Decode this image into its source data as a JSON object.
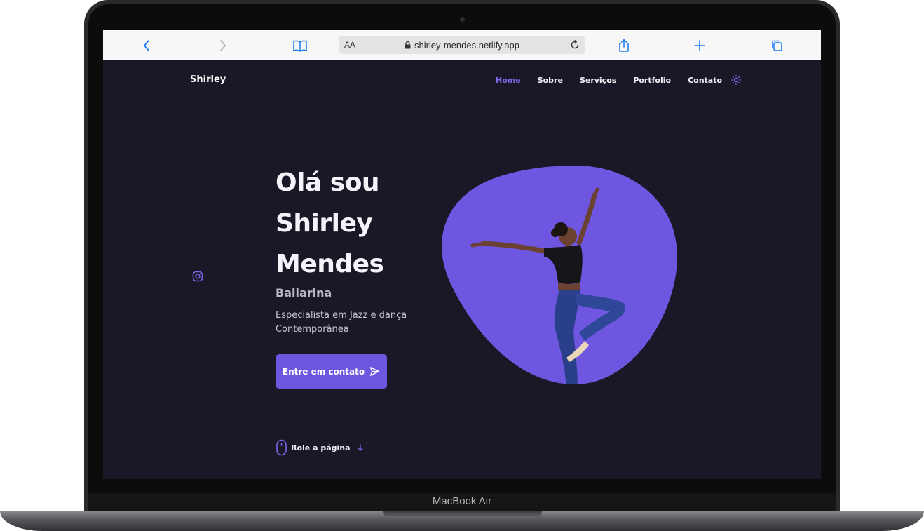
{
  "device": {
    "model_label": "MacBook Air"
  },
  "browser": {
    "text_size_label": "AA",
    "url": "shirley-mendes.netlify.app"
  },
  "site": {
    "logo": "Shirley",
    "nav": {
      "items": [
        {
          "label": "Home",
          "active": true
        },
        {
          "label": "Sobre",
          "active": false
        },
        {
          "label": "Serviços",
          "active": false
        },
        {
          "label": "Portfolio",
          "active": false
        },
        {
          "label": "Contato",
          "active": false
        }
      ]
    },
    "hero": {
      "title_lines": [
        "Olá sou",
        "Shirley",
        "Mendes"
      ],
      "subtitle": "Bailarina",
      "description": "Especialista em Jazz e dança Contemporânea",
      "cta_label": "Entre em contato",
      "scroll_label": "Role a página"
    }
  },
  "icons": {
    "social": "instagram-icon",
    "theme": "sun-icon",
    "cta": "send-icon",
    "scroll": "mouse-icon"
  },
  "colors": {
    "background": "#1a1726",
    "accent": "#6f56e0",
    "accent_text": "#7a66e8",
    "text": "#f4f3f9",
    "muted_text": "#b9b6c7"
  }
}
